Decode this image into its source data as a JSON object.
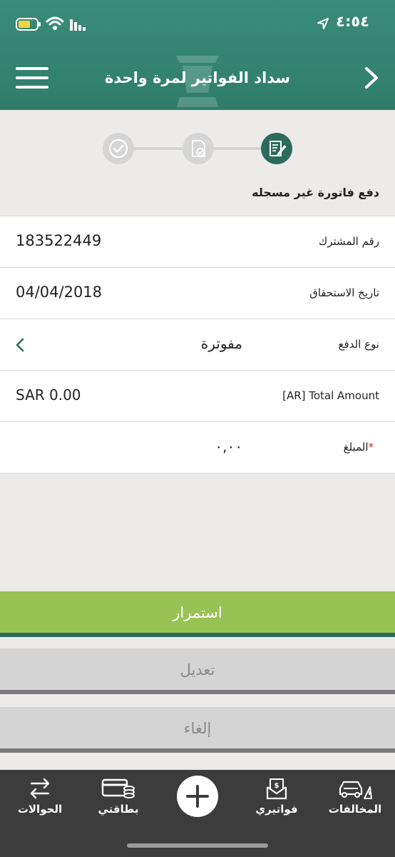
{
  "status_bar": {
    "time": "٤:٥٤"
  },
  "header": {
    "title": "سداد الفواتير لمرة واحدة"
  },
  "stepper": {
    "caption": "دفع فاتورة غير مسجله"
  },
  "form": {
    "subscriber_label": "رقم المشترك",
    "subscriber_value": "183522449",
    "due_date_label": "تاريخ الاستحقاق",
    "due_date_value": "04/04/2018",
    "payment_type_label": "نوع الدفع",
    "payment_type_value": "مفوترة",
    "total_label": "[AR] Total Amount",
    "total_value": "SAR 0.00",
    "amount_label": "المبلغ",
    "amount_required_mark": "*",
    "amount_value": "٠,٠٠"
  },
  "buttons": {
    "continue": "استمرار",
    "edit": "تعديل",
    "cancel": "إلغاء"
  },
  "tabbar": {
    "transfers": "الحوالات",
    "cards": "بطاقتي",
    "bills": "فواتيري",
    "violations": "المخالفات"
  },
  "colors": {
    "header": "#2f7d69",
    "primary_button": "#97c355",
    "active_step": "#2a6b5a",
    "tabbar": "#3c3c3d",
    "required": "#c62828"
  },
  "icons": [
    "menu-icon",
    "back-chevron-icon",
    "check-circle-icon",
    "document-check-icon",
    "edit-document-icon",
    "chevron-left-icon",
    "transfer-icon",
    "card-coins-icon",
    "plus-icon",
    "bill-envelope-icon",
    "car-warning-icon"
  ]
}
